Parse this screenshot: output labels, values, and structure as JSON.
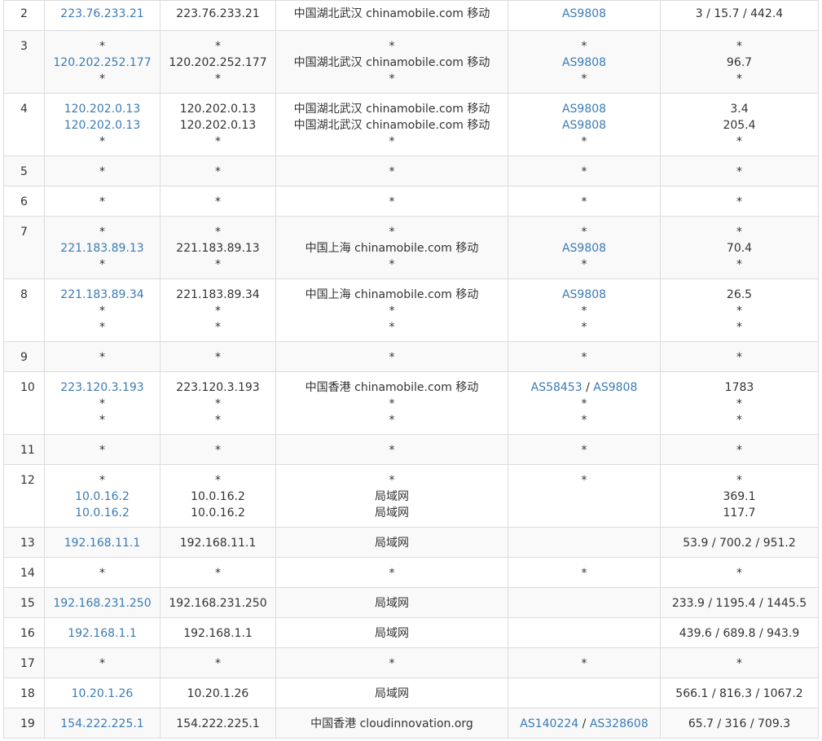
{
  "rows": [
    {
      "hop": "2",
      "ip": [
        "223.76.233.21"
      ],
      "host": [
        "223.76.233.21"
      ],
      "loc": [
        "中国湖北武汉 chinamobile.com 移动"
      ],
      "as": [
        [
          "AS9808"
        ]
      ],
      "rtt": [
        "3 / 15.7 / 442.4"
      ],
      "h": 37
    },
    {
      "hop": "3",
      "ip": [
        "*",
        "120.202.252.177",
        "*"
      ],
      "host": [
        "*",
        "120.202.252.177",
        "*"
      ],
      "loc": [
        "*",
        "中国湖北武汉 chinamobile.com 移动",
        "*"
      ],
      "as": [
        [
          "*"
        ],
        [
          "AS9808"
        ],
        [
          "*"
        ]
      ],
      "rtt": [
        "*",
        "96.7",
        "*"
      ],
      "h": 77
    },
    {
      "hop": "4",
      "ip": [
        "120.202.0.13",
        "120.202.0.13",
        "*"
      ],
      "host": [
        "120.202.0.13",
        "120.202.0.13",
        "*"
      ],
      "loc": [
        "中国湖北武汉 chinamobile.com 移动",
        "中国湖北武汉 chinamobile.com 移动",
        "*"
      ],
      "as": [
        [
          "AS9808"
        ],
        [
          "AS9808"
        ],
        [
          "*"
        ]
      ],
      "rtt": [
        "3.4",
        "205.4",
        "*"
      ],
      "h": 77
    },
    {
      "hop": "5",
      "ip": [
        "*"
      ],
      "host": [
        "*"
      ],
      "loc": [
        "*"
      ],
      "as": [
        [
          "*"
        ]
      ],
      "rtt": [
        "*"
      ],
      "h": 37
    },
    {
      "hop": "6",
      "ip": [
        "*"
      ],
      "host": [
        "*"
      ],
      "loc": [
        "*"
      ],
      "as": [
        [
          "*"
        ]
      ],
      "rtt": [
        "*"
      ],
      "h": 37
    },
    {
      "hop": "7",
      "ip": [
        "*",
        "221.183.89.13",
        "*"
      ],
      "host": [
        "*",
        "221.183.89.13",
        "*"
      ],
      "loc": [
        "*",
        "中国上海 chinamobile.com 移动",
        "*"
      ],
      "as": [
        [
          "*"
        ],
        [
          "AS9808"
        ],
        [
          "*"
        ]
      ],
      "rtt": [
        "*",
        "70.4",
        "*"
      ],
      "h": 77
    },
    {
      "hop": "8",
      "ip": [
        "221.183.89.34",
        "*",
        "*"
      ],
      "host": [
        "221.183.89.34",
        "*",
        "*"
      ],
      "loc": [
        "中国上海 chinamobile.com 移动",
        "*",
        "*"
      ],
      "as": [
        [
          "AS9808"
        ],
        [
          "*"
        ],
        [
          "*"
        ]
      ],
      "rtt": [
        "26.5",
        "*",
        "*"
      ],
      "h": 77
    },
    {
      "hop": "9",
      "ip": [
        "*"
      ],
      "host": [
        "*"
      ],
      "loc": [
        "*"
      ],
      "as": [
        [
          "*"
        ]
      ],
      "rtt": [
        "*"
      ],
      "h": 37
    },
    {
      "hop": "10",
      "ip": [
        "223.120.3.193",
        "*",
        "*"
      ],
      "host": [
        "223.120.3.193",
        "*",
        "*"
      ],
      "loc": [
        "中国香港 chinamobile.com 移动",
        "*",
        "*"
      ],
      "as": [
        [
          "AS58453",
          "AS9808"
        ],
        [
          "*"
        ],
        [
          "*"
        ]
      ],
      "rtt": [
        "1783",
        "*",
        "*"
      ],
      "h": 77
    },
    {
      "hop": "11",
      "ip": [
        "*"
      ],
      "host": [
        "*"
      ],
      "loc": [
        "*"
      ],
      "as": [
        [
          "*"
        ]
      ],
      "rtt": [
        "*"
      ],
      "h": 37
    },
    {
      "hop": "12",
      "ip": [
        "*",
        "10.0.16.2",
        "10.0.16.2"
      ],
      "host": [
        "*",
        "10.0.16.2",
        "10.0.16.2"
      ],
      "loc": [
        "*",
        "局域网",
        "局域网"
      ],
      "as": [
        [
          "*"
        ]
      ],
      "rtt": [
        "*",
        "369.1",
        "117.7"
      ],
      "h": 77
    },
    {
      "hop": "13",
      "ip": [
        "192.168.11.1"
      ],
      "host": [
        "192.168.11.1"
      ],
      "loc": [
        "局域网"
      ],
      "as": [],
      "rtt": [
        "53.9 / 700.2 / 951.2"
      ],
      "h": 37
    },
    {
      "hop": "14",
      "ip": [
        "*"
      ],
      "host": [
        "*"
      ],
      "loc": [
        "*"
      ],
      "as": [
        [
          "*"
        ]
      ],
      "rtt": [
        "*"
      ],
      "h": 37
    },
    {
      "hop": "15",
      "ip": [
        "192.168.231.250"
      ],
      "host": [
        "192.168.231.250"
      ],
      "loc": [
        "局域网"
      ],
      "as": [],
      "rtt": [
        "233.9 / 1195.4 / 1445.5"
      ],
      "h": 37
    },
    {
      "hop": "16",
      "ip": [
        "192.168.1.1"
      ],
      "host": [
        "192.168.1.1"
      ],
      "loc": [
        "局域网"
      ],
      "as": [],
      "rtt": [
        "439.6 / 689.8 / 943.9"
      ],
      "h": 37
    },
    {
      "hop": "17",
      "ip": [
        "*"
      ],
      "host": [
        "*"
      ],
      "loc": [
        "*"
      ],
      "as": [
        [
          "*"
        ]
      ],
      "rtt": [
        "*"
      ],
      "h": 37
    },
    {
      "hop": "18",
      "ip": [
        "10.20.1.26"
      ],
      "host": [
        "10.20.1.26"
      ],
      "loc": [
        "局域网"
      ],
      "as": [],
      "rtt": [
        "566.1 / 816.3 / 1067.2"
      ],
      "h": 37
    },
    {
      "hop": "19",
      "ip": [
        "154.222.225.1"
      ],
      "host": [
        "154.222.225.1"
      ],
      "loc": [
        "中国香港 cloudinnovation.org"
      ],
      "as": [
        [
          "AS140224",
          "AS328608"
        ]
      ],
      "rtt": [
        "65.7 / 316 / 709.3"
      ],
      "h": 37
    }
  ],
  "colors": {
    "link": "#3a7bb5",
    "text": "#333333",
    "border": "#dcdcdc",
    "stripe": "#f9f9f9"
  }
}
